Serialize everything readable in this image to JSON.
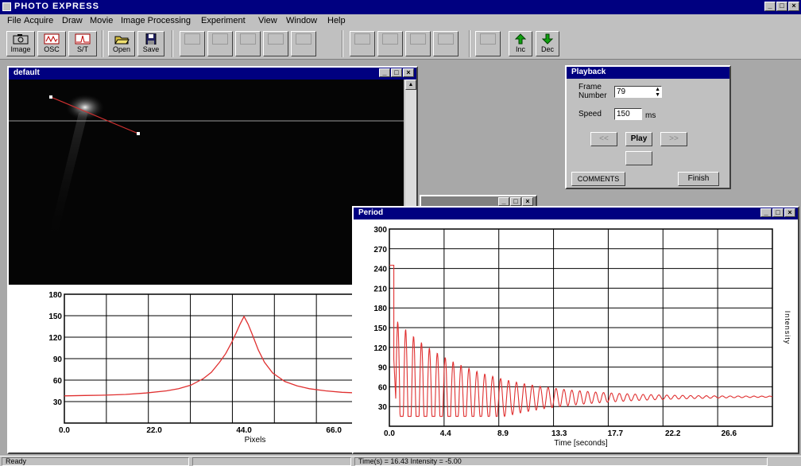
{
  "app": {
    "title": "PHOTO EXPRESS"
  },
  "menu": [
    "File",
    "Acquire",
    "Draw",
    "Movie",
    "Image Processing",
    "Experiment",
    "View",
    "Window",
    "Help"
  ],
  "toolbar": {
    "image": "Image",
    "osc": "OSC",
    "st": "S/T",
    "open": "Open",
    "save": "Save",
    "inc": "Inc",
    "dec": "Dec"
  },
  "image_window": {
    "title": "default"
  },
  "playback": {
    "title": "Playback",
    "frame_label": "Frame Number",
    "frame_value": "79",
    "speed_label": "Speed",
    "speed_value": "150",
    "speed_unit": "ms",
    "rewind": "<<",
    "play": "Play",
    "forward": ">>",
    "comments": "COMMENTS",
    "finish": "Finish"
  },
  "period_window": {
    "title": "Period"
  },
  "status": {
    "left": "Ready",
    "right": "Time(s) = 16.43 Intensity = -5.00"
  },
  "colors": {
    "titlebar": "#000080",
    "trace": "#e03030",
    "chrome": "#c0c0c0"
  },
  "chart_data": [
    {
      "type": "line",
      "title": "",
      "xlabel": "Pixels",
      "ylabel": "",
      "xlim": [
        0,
        72
      ],
      "ylim": [
        0,
        180
      ],
      "xticks": [
        "0.0",
        "22.0",
        "44.0",
        "66.0"
      ],
      "yticks": [
        "30",
        "60",
        "90",
        "120",
        "150",
        "180"
      ],
      "grid": true,
      "series": [
        {
          "x": [
            0,
            5,
            10,
            15,
            20,
            25,
            28,
            31,
            34,
            36,
            38,
            39.5,
            41,
            42,
            43,
            44,
            45,
            46,
            47.5,
            49,
            51,
            54,
            57,
            60,
            64,
            68,
            72
          ],
          "y": [
            38,
            38.5,
            39,
            40,
            42,
            45,
            48,
            53,
            62,
            71,
            85,
            97,
            113,
            125,
            138,
            149,
            138,
            124,
            102,
            85,
            70,
            58,
            52,
            48,
            45,
            43,
            42
          ]
        }
      ]
    },
    {
      "type": "line",
      "title": "",
      "xlabel": "Time [seconds]",
      "ylabel": "Intensity",
      "xlim": [
        0,
        30
      ],
      "ylim": [
        0,
        300
      ],
      "xticks": [
        "0.0",
        "4.4",
        "8.9",
        "13.3",
        "17.7",
        "22.2",
        "26.6"
      ],
      "yticks": [
        "30",
        "60",
        "90",
        "120",
        "150",
        "180",
        "210",
        "240",
        "270",
        "300"
      ],
      "grid": true,
      "series": [
        {
          "damped_oscillation": {
            "initial": 245,
            "drop_at": 0.35,
            "baseline": 42,
            "amplitude": 120,
            "period": 0.62,
            "decay": 0.17,
            "start": 0.5,
            "end": 30,
            "final_baseline": 45
          }
        }
      ]
    }
  ]
}
